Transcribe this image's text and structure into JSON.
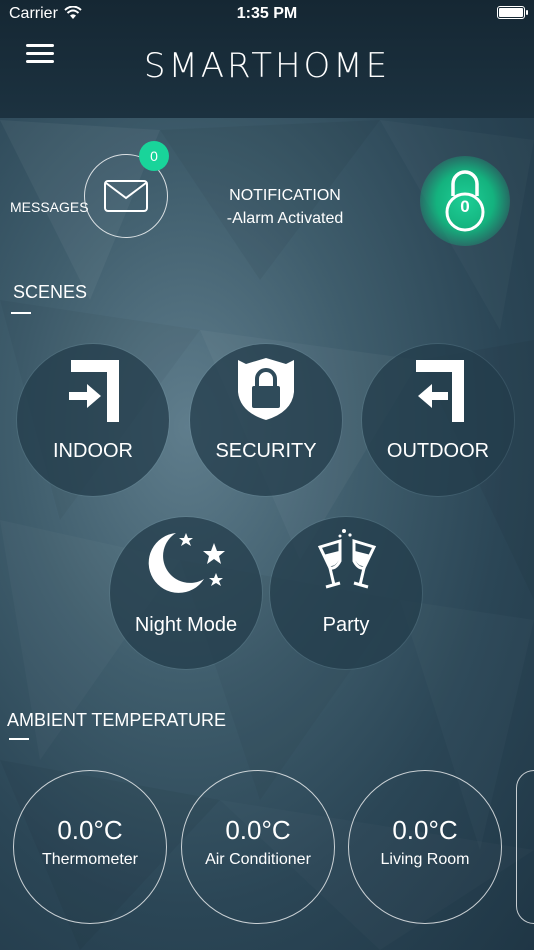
{
  "status": {
    "carrier": "Carrier",
    "time": "1:35 PM"
  },
  "header": {
    "title": "SMARTHOME"
  },
  "messages": {
    "label": "MESSAGES",
    "count": "0"
  },
  "notification": {
    "title": "NOTIFICATION",
    "text": "-Alarm Activated"
  },
  "lock": {
    "count": "0"
  },
  "scenes": {
    "title": "SCENES",
    "items": [
      {
        "label": "INDOOR",
        "icon": "enter-door-icon"
      },
      {
        "label": "SECURITY",
        "icon": "shield-lock-icon"
      },
      {
        "label": "OUTDOOR",
        "icon": "exit-door-icon"
      },
      {
        "label": "Night Mode",
        "icon": "moon-stars-icon"
      },
      {
        "label": "Party",
        "icon": "champagne-glasses-icon"
      }
    ]
  },
  "ambient": {
    "title": "AMBIENT TEMPERATURE",
    "items": [
      {
        "value": "0.0°C",
        "name": "Thermometer"
      },
      {
        "value": "0.0°C",
        "name": "Air Conditioner"
      },
      {
        "value": "0.0°C",
        "name": "Living Room"
      }
    ]
  },
  "colors": {
    "accent": "#19d49a",
    "background": "#2b4656",
    "header": "#152733"
  }
}
